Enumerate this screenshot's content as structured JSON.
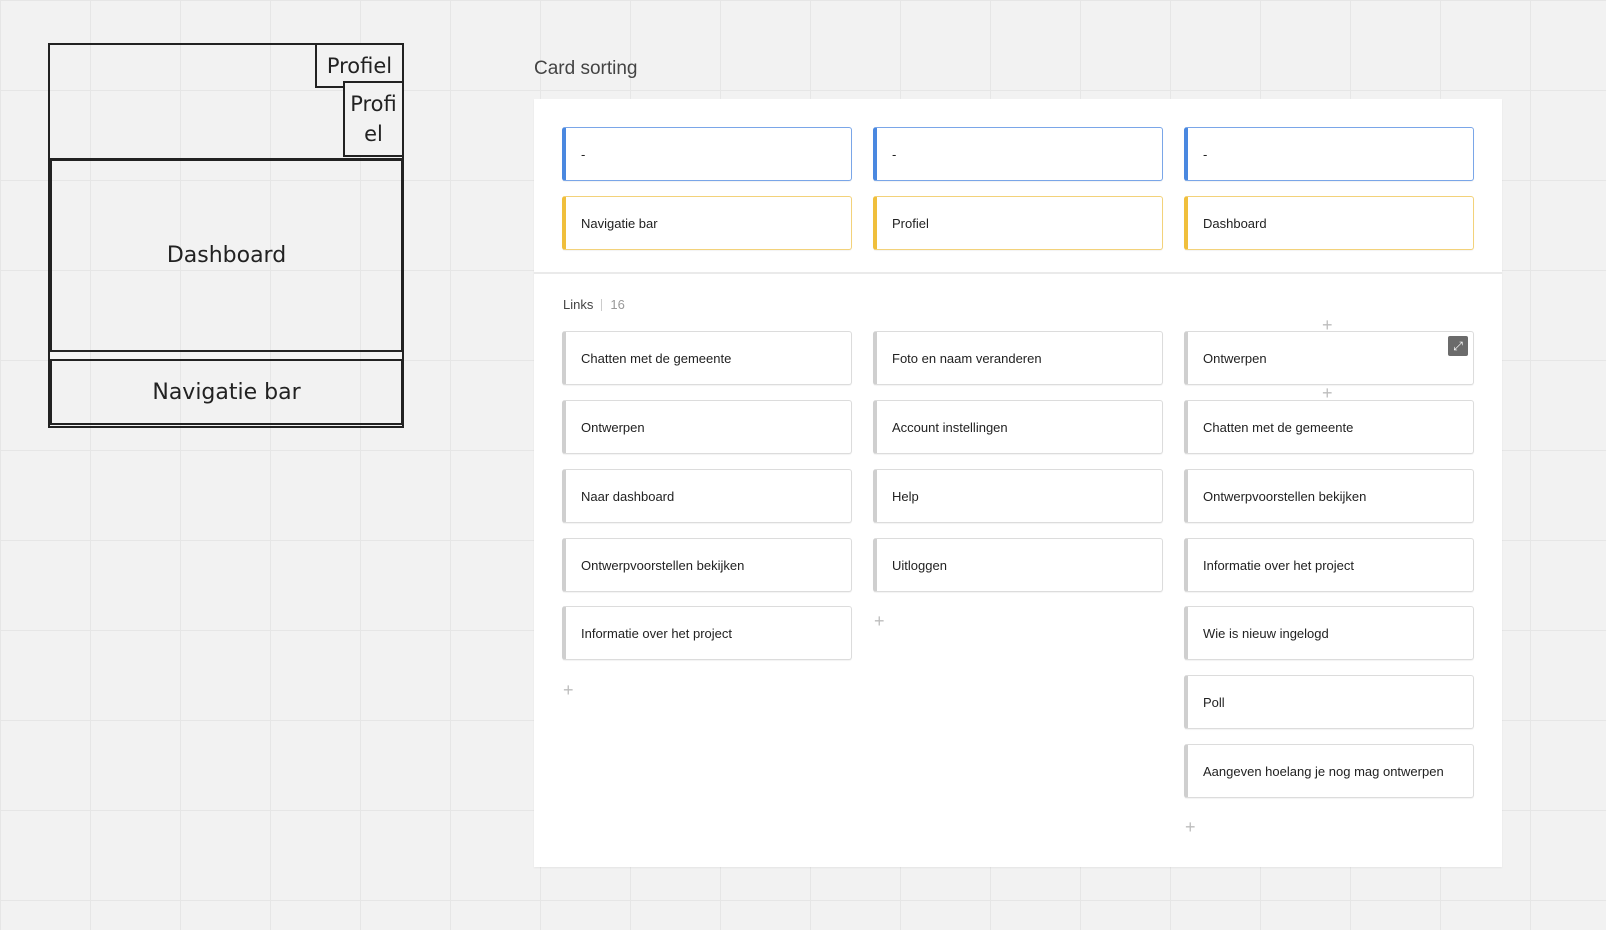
{
  "wireframe": {
    "profiel_top": "Profiel",
    "profiel_side": "Profi el",
    "dashboard": "Dashboard",
    "navigation": "Navigatie bar"
  },
  "board": {
    "title": "Card sorting",
    "headers": [
      "-",
      "-",
      "-"
    ],
    "categories": [
      "Navigatie bar",
      "Profiel",
      "Dashboard"
    ],
    "group_name": "Links",
    "group_count": "16",
    "columns": [
      [
        "Chatten met de gemeente",
        "Ontwerpen",
        "Naar dashboard",
        "Ontwerpvoorstellen bekijken",
        "Informatie over het project"
      ],
      [
        "Foto en naam veranderen",
        "Account instellingen",
        "Help",
        "Uitloggen"
      ],
      [
        "Ontwerpen",
        "Chatten met de gemeente",
        "Ontwerpvoorstellen bekijken",
        "Informatie over het project",
        "Wie is nieuw ingelogd",
        "Poll",
        "Aangeven hoelang je nog mag ontwerpen"
      ]
    ]
  },
  "icons": {
    "add": "plus-icon",
    "expand": "expand-icon"
  },
  "colors": {
    "header_accent": "#4a88e0",
    "category_accent": "#f0bf3c",
    "card_accent": "#cfcfcf"
  }
}
